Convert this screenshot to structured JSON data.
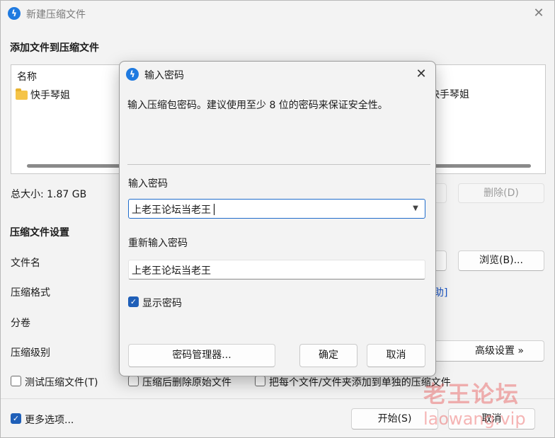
{
  "window": {
    "title": "新建压缩文件",
    "add_files_heading": "添加文件到压缩文件",
    "file_list": {
      "column_name": "名称",
      "items": [
        "快手琴姐"
      ],
      "right_item": "快手琴姐"
    },
    "total_size_label": "总大小: 1.87 GB",
    "delete_button": "删除(D)",
    "settings_heading": "压缩文件设置",
    "filename_label": "文件名",
    "browse_button": "浏览(B)...",
    "format_label": "压缩格式",
    "help_link": "助]",
    "split_label": "分卷",
    "level_label": "压缩级别",
    "advanced_button": "高级设置 »",
    "test_archive_label": "测试压缩文件(T)",
    "delete_after_label": "压缩后删除原始文件",
    "each_separate_label": "把每个文件/文件夹添加到单独的压缩文件",
    "more_options_label": "更多选项...",
    "start_button": "开始(S)",
    "cancel_button": "取消"
  },
  "dialog": {
    "title": "输入密码",
    "description": "输入压缩包密码。建议使用至少 8 位的密码来保证安全性。",
    "password_label": "输入密码",
    "password_value": "上老王论坛当老王",
    "reenter_label": "重新输入密码",
    "reenter_value": "上老王论坛当老王",
    "show_password_label": "显示密码",
    "show_password_checked": true,
    "manager_button": "密码管理器...",
    "ok_button": "确定",
    "cancel_button": "取消"
  },
  "watermark": {
    "line1": "老王论坛",
    "line2": "laowang.vip"
  },
  "icons": {
    "app": "bolt-icon",
    "close": "close-icon",
    "folder": "folder-icon",
    "dropdown": "chevron-down-icon",
    "check": "checkmark-icon"
  },
  "colors": {
    "accent": "#1f6ccb",
    "watermark": "#e73c3c"
  }
}
